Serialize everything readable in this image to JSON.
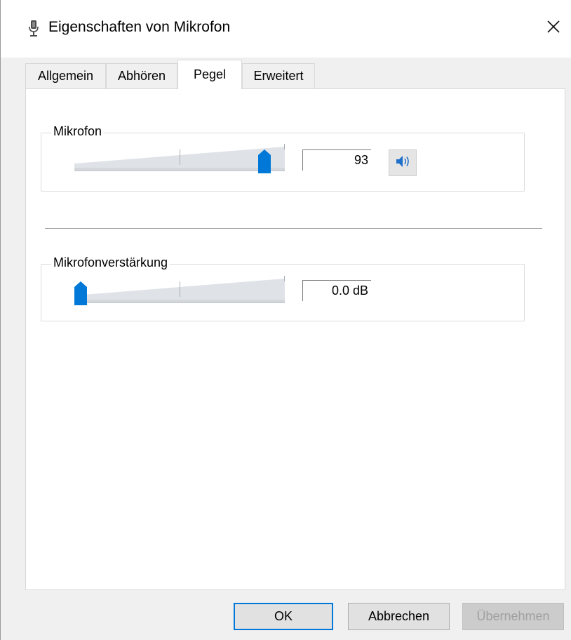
{
  "window": {
    "title": "Eigenschaften von Mikrofon",
    "title_icon": "microphone-icon",
    "close_icon": "close-icon"
  },
  "tabs": [
    {
      "label": "Allgemein",
      "active": false
    },
    {
      "label": "Abhören",
      "active": false
    },
    {
      "label": "Pegel",
      "active": true
    },
    {
      "label": "Erweitert",
      "active": false
    }
  ],
  "levels": {
    "microphone": {
      "label": "Mikrofon",
      "value_text": "93",
      "level": 93,
      "range": [
        0,
        100
      ],
      "speaker_icon": "speaker-icon"
    },
    "boost": {
      "label": "Mikrofonverstärkung",
      "value_text": "0.0 dB",
      "level": 0,
      "range": [
        0,
        100
      ]
    }
  },
  "colors": {
    "accent": "#0078d7",
    "slider_track": "#dfe3e8"
  },
  "buttons": {
    "ok": "OK",
    "cancel": "Abbrechen",
    "apply": "Übernehmen",
    "apply_enabled": false
  }
}
